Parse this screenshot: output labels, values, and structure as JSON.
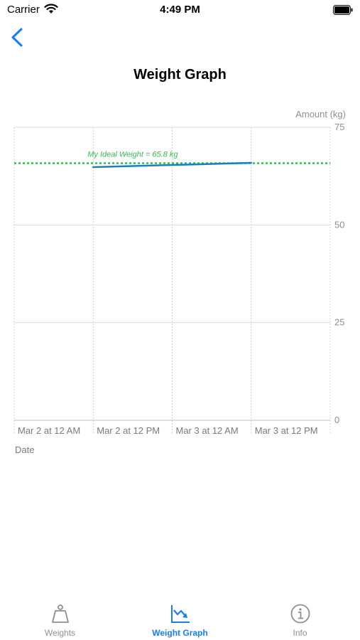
{
  "status_bar": {
    "carrier": "Carrier",
    "time": "4:49 PM"
  },
  "nav": {
    "title": "Weight Graph"
  },
  "chart_data": {
    "type": "line",
    "title": "",
    "ylabel": "Amount (kg)",
    "xlabel": "Date",
    "ylim": [
      0,
      75
    ],
    "yticks": [
      0,
      25,
      50,
      75
    ],
    "xticks": [
      "Mar 2 at 12 AM",
      "Mar 2 at 12 PM",
      "Mar 3 at 12 AM",
      "Mar 3 at 12 PM"
    ],
    "series": [
      {
        "color": "#1c7dc7",
        "points": [
          {
            "x": "Mar 2 at 12 PM",
            "y": 64.8
          },
          {
            "x": "Mar 3 at 12 PM",
            "y": 65.9
          }
        ]
      }
    ],
    "reference_line": {
      "y": 65.8,
      "label": "My Ideal Weight = 65.8 kg",
      "color": "#2fbf4f",
      "style": "dotted"
    },
    "grid": true
  },
  "tabs": [
    {
      "label": "Weights",
      "icon": "weight-icon",
      "active": false
    },
    {
      "label": "Weight Graph",
      "icon": "chart-icon",
      "active": true
    },
    {
      "label": "Info",
      "icon": "info-icon",
      "active": false
    }
  ],
  "colors": {
    "accent": "#1a7cf3",
    "line": "#1c7dc7",
    "ideal": "#2fbf4f",
    "inactive": "#8e8e93"
  }
}
